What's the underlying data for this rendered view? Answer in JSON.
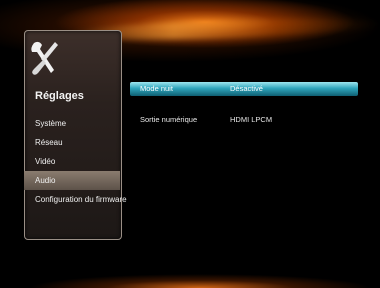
{
  "sidebar": {
    "title": "Réglages",
    "icon": "tools-icon",
    "items": [
      {
        "label": "Système"
      },
      {
        "label": "Réseau"
      },
      {
        "label": "Vidéo"
      },
      {
        "label": "Audio"
      },
      {
        "label": "Configuration du firmware"
      }
    ],
    "selected": "Audio"
  },
  "settings": [
    {
      "label": "Mode nuit",
      "value": "Désactivé"
    },
    {
      "label": "Sortie numérique",
      "value": "HDMI LPCM"
    }
  ],
  "colors": {
    "highlight": "#2fa5bc",
    "accent_glow": "#f07814"
  }
}
